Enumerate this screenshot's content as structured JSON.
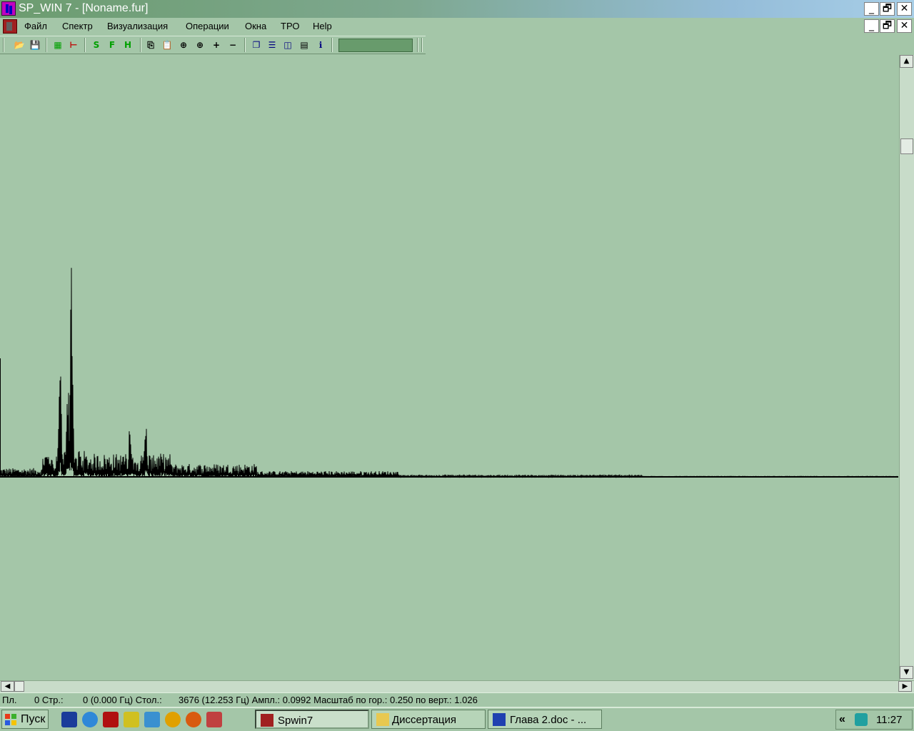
{
  "window": {
    "title": "SP_WIN 7 - [Noname.fur]",
    "buttons": {
      "minimize": "_",
      "restore": "🗗",
      "close": "✕"
    }
  },
  "menu": {
    "items": [
      "Файл",
      "Спектр",
      "Визуализация",
      "Операции",
      "Окна",
      "ТРО",
      "Help"
    ]
  },
  "toolbar": {
    "buttons": [
      {
        "name": "open-icon",
        "glyph": "📂",
        "color": "#c08000"
      },
      {
        "name": "save-icon",
        "glyph": "💾",
        "color": "#000080"
      },
      {
        "name": "grid-icon",
        "glyph": "▦",
        "color": "#00a000"
      },
      {
        "name": "cursor-line-icon",
        "glyph": "⊢",
        "color": "#c00000"
      },
      {
        "name": "s-icon",
        "glyph": "S",
        "color": "#00a000"
      },
      {
        "name": "f-icon",
        "glyph": "F",
        "color": "#00a000"
      },
      {
        "name": "h-icon",
        "glyph": "H",
        "color": "#00a000"
      },
      {
        "name": "copy-icon",
        "glyph": "⎘",
        "color": "#000"
      },
      {
        "name": "paste-icon",
        "glyph": "📋",
        "color": "#000"
      },
      {
        "name": "zoom-vertical-icon",
        "glyph": "⊕",
        "color": "#000"
      },
      {
        "name": "zoom-horizontal-icon",
        "glyph": "⊕",
        "color": "#000"
      },
      {
        "name": "zoom-in-icon",
        "glyph": "+",
        "color": "#000"
      },
      {
        "name": "zoom-out-icon",
        "glyph": "−",
        "color": "#000"
      },
      {
        "name": "cascade-icon",
        "glyph": "❐",
        "color": "#000080"
      },
      {
        "name": "tile-horizontal-icon",
        "glyph": "☰",
        "color": "#000080"
      },
      {
        "name": "tile-vertical-icon",
        "glyph": "◫",
        "color": "#000080"
      },
      {
        "name": "properties-icon",
        "glyph": "▤",
        "color": "#000"
      },
      {
        "name": "info-icon",
        "glyph": "ℹ",
        "color": "#000080"
      }
    ]
  },
  "chart_data": {
    "type": "line",
    "description_series": "spectrum amplitude",
    "x_unit_max_column": 3676,
    "peaks": [
      {
        "column": 100,
        "amplitude": 1.0
      },
      {
        "column": 84,
        "amplitude": 0.6
      },
      {
        "column": 95,
        "amplitude": 0.45
      },
      {
        "column": 182,
        "amplitude": 0.25
      },
      {
        "column": 204,
        "amplitude": 0.27
      }
    ],
    "colors": {
      "line": "#000000",
      "background": "#a4c6a8"
    }
  },
  "scrollbars": {
    "up": "▲",
    "down": "▼",
    "left": "◀",
    "right": "▶"
  },
  "status": {
    "pl": "Пл.",
    "str": "0 Стр.:",
    "str_val": "0 (0.000 Гц) Стол.:",
    "col_val": "3676 (12.253 Гц) Ампл.: 0.0992 Масштаб по гор.: 0.250 по верт.: 1.026"
  },
  "taskbar": {
    "start": "Пуск",
    "tasks": [
      {
        "label": "Spwin7",
        "active": true
      },
      {
        "label": "Диссертация",
        "active": false
      },
      {
        "label": "Глава 2.doc - ...",
        "active": false
      }
    ],
    "tray_chevron": "«",
    "clock": "11:27"
  }
}
